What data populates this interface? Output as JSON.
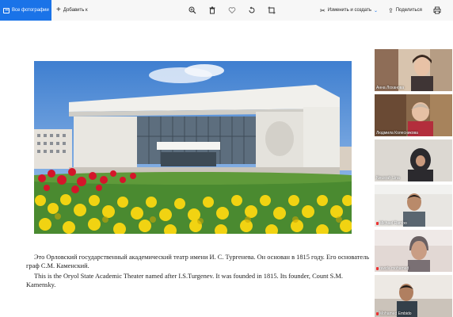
{
  "toolbar": {
    "all_photos_label": "Все фотографии",
    "add_to_label": "Добавить к",
    "edit_create_label": "Изменить и создать",
    "share_label": "Поделиться"
  },
  "slide": {
    "caption_ru": "Это Орловский государственный академический театр имени И. С. Тургенева. Он основан в 1815 году. Его основатель граф С.М. Каменский.",
    "caption_en": "This is the Oryol State Academic Theater named after I.S.Turgenev. It was founded in 1815. Its founder, Count S.M. Kamensky."
  },
  "participants": [
    {
      "name": "Анна Лоханова",
      "muted": false
    },
    {
      "name": "Людмила Колесникова",
      "muted": false
    },
    {
      "name": "Neusrah Lina",
      "muted": false
    },
    {
      "name": "Michael Rambo",
      "muted": true
    },
    {
      "name": "rawda mohamed",
      "muted": true
    },
    {
      "name": "Mohamed Embido",
      "muted": true
    }
  ]
}
